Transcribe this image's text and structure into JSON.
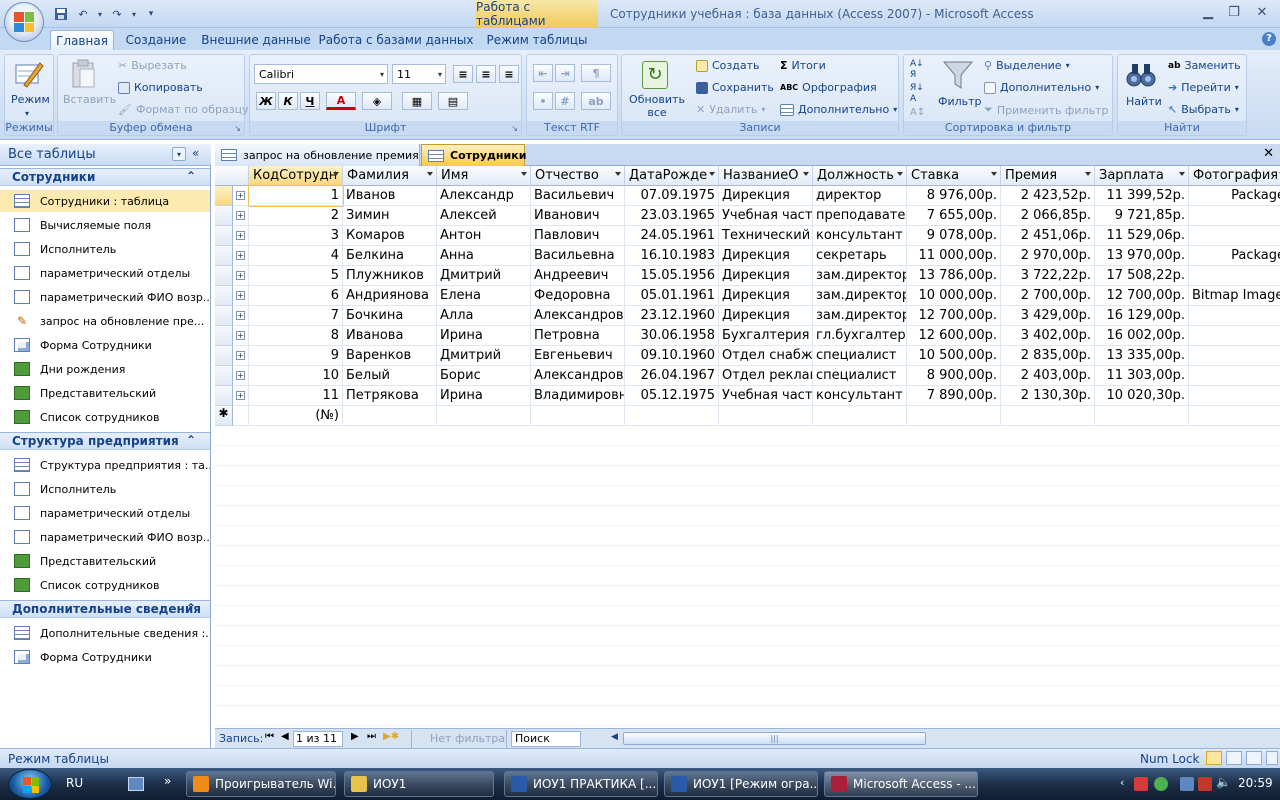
{
  "window": {
    "context_tab_title": "Работа с таблицами",
    "title": "Сотрудники учебная : база данных (Access 2007)  -  Microsoft Access"
  },
  "ribbon_tabs": [
    "Главная",
    "Создание",
    "Внешние данные",
    "Работа с базами данных",
    "Режим таблицы"
  ],
  "ribbon": {
    "modes": {
      "view_label": "Режим",
      "group": "Режимы"
    },
    "clipboard": {
      "paste": "Вставить",
      "cut": "Вырезать",
      "copy": "Копировать",
      "format_painter": "Формат по образцу",
      "group": "Буфер обмена"
    },
    "font": {
      "name": "Calibri",
      "size": "11",
      "bold": "Ж",
      "italic": "К",
      "underline": "Ч",
      "font_color": "А",
      "group": "Шрифт"
    },
    "rtf": {
      "group": "Текст RTF"
    },
    "records": {
      "refresh": "Обновить все",
      "new": "Создать",
      "save": "Сохранить",
      "delete": "Удалить",
      "totals": "Итоги",
      "spelling": "Орфография",
      "more": "Дополнительно",
      "group": "Записи"
    },
    "sort_filter": {
      "filter": "Фильтр",
      "selection": "Выделение",
      "advanced": "Дополнительно",
      "toggle_filter": "Применить фильтр",
      "group": "Сортировка и фильтр"
    },
    "find": {
      "find": "Найти",
      "replace": "Заменить",
      "goto": "Перейти",
      "select": "Выбрать",
      "group": "Найти"
    }
  },
  "nav": {
    "header": "Все таблицы",
    "groups": [
      {
        "title": "Сотрудники",
        "items": [
          {
            "label": "Сотрудники : таблица",
            "icon": "table"
          },
          {
            "label": "Вычисляемые поля",
            "icon": "query"
          },
          {
            "label": "Исполнитель",
            "icon": "query"
          },
          {
            "label": "параметрический отделы",
            "icon": "query"
          },
          {
            "label": "параметрический ФИО возр...",
            "icon": "query"
          },
          {
            "label": "запрос на обновление пре...",
            "icon": "update"
          },
          {
            "label": "Форма Сотрудники",
            "icon": "form"
          },
          {
            "label": "Дни рождения",
            "icon": "report"
          },
          {
            "label": "Представительский",
            "icon": "report"
          },
          {
            "label": "Список сотрудников",
            "icon": "report"
          }
        ]
      },
      {
        "title": "Структура предприятия",
        "items": [
          {
            "label": "Структура предприятия : та...",
            "icon": "table"
          },
          {
            "label": "Исполнитель",
            "icon": "query"
          },
          {
            "label": "параметрический отделы",
            "icon": "query"
          },
          {
            "label": "параметрический ФИО возр...",
            "icon": "query"
          },
          {
            "label": "Представительский",
            "icon": "report"
          },
          {
            "label": "Список сотрудников",
            "icon": "report"
          }
        ]
      },
      {
        "title": "Дополнительные сведения",
        "items": [
          {
            "label": "Дополнительные сведения :...",
            "icon": "table"
          },
          {
            "label": "Форма Сотрудники",
            "icon": "form"
          }
        ]
      }
    ]
  },
  "doc_tabs": [
    "запрос на обновление премия",
    "Сотрудники"
  ],
  "table": {
    "columns": [
      "КодСотрудн",
      "Фамилия",
      "Имя",
      "Отчество",
      "ДатаРожде",
      "НазваниеО",
      "Должность",
      "Ставка",
      "Премия",
      "Зарплата",
      "Фотография"
    ],
    "rows": [
      [
        "1",
        "Иванов",
        "Александр",
        "Васильевич",
        "07.09.1975",
        "Дирекция",
        "директор",
        "8 976,00р.",
        "2 423,52р.",
        "11 399,52р.",
        "Package"
      ],
      [
        "2",
        "Зимин",
        "Алексей",
        "Иванович",
        "23.03.1965",
        "Учебная часть",
        "преподавател",
        "7 655,00р.",
        "2 066,85р.",
        "9 721,85р.",
        ""
      ],
      [
        "3",
        "Комаров",
        "Антон",
        "Павлович",
        "24.05.1961",
        "Технический с",
        "консультант",
        "9 078,00р.",
        "2 451,06р.",
        "11 529,06р.",
        ""
      ],
      [
        "4",
        "Белкина",
        "Анна",
        "Васильевна",
        "16.10.1983",
        "Дирекция",
        "секретарь",
        "11 000,00р.",
        "2 970,00р.",
        "13 970,00р.",
        "Package"
      ],
      [
        "5",
        "Плужников",
        "Дмитрий",
        "Андреевич",
        "15.05.1956",
        "Дирекция",
        "зам.директор",
        "13 786,00р.",
        "3 722,22р.",
        "17 508,22р.",
        ""
      ],
      [
        "6",
        "Андриянова",
        "Елена",
        "Федоровна",
        "05.01.1961",
        "Дирекция",
        "зам.директор",
        "10 000,00р.",
        "2 700,00р.",
        "12 700,00р.",
        "Bitmap Image"
      ],
      [
        "7",
        "Бочкина",
        "Алла",
        "Александровн",
        "23.12.1960",
        "Дирекция",
        "зам.директор",
        "12 700,00р.",
        "3 429,00р.",
        "16 129,00р.",
        ""
      ],
      [
        "8",
        "Иванова",
        "Ирина",
        "Петровна",
        "30.06.1958",
        "Бухгалтерия",
        "гл.бухгалтер",
        "12 600,00р.",
        "3 402,00р.",
        "16 002,00р.",
        ""
      ],
      [
        "9",
        "Варенков",
        "Дмитрий",
        "Евгеньевич",
        "09.10.1960",
        "Отдел снабже",
        "специалист",
        "10 500,00р.",
        "2 835,00р.",
        "13 335,00р.",
        ""
      ],
      [
        "10",
        "Белый",
        "Борис",
        "Александрови",
        "26.04.1967",
        "Отдел реклам",
        "специалист",
        "8 900,00р.",
        "2 403,00р.",
        "11 303,00р.",
        ""
      ],
      [
        "11",
        "Петрякова",
        "Ирина",
        "Владимировн",
        "05.12.1975",
        "Учебная часть",
        "консультант",
        "7 890,00р.",
        "2 130,30р.",
        "10 020,30р.",
        ""
      ]
    ],
    "new_row_label": "(№)"
  },
  "recbar": {
    "label": "Запись:",
    "position": "1 из 11",
    "filter": "Нет фильтра",
    "search": "Поиск"
  },
  "status": {
    "mode": "Режим таблицы",
    "numlock": "Num Lock"
  },
  "taskbar": {
    "lang": "RU",
    "items": [
      "Проигрыватель Wi...",
      "ИОУ1",
      "ИОУ1 ПРАКТИКА [...",
      "ИОУ1 [Режим огра...",
      "Microsoft Access - ..."
    ],
    "clock": "20:59"
  }
}
